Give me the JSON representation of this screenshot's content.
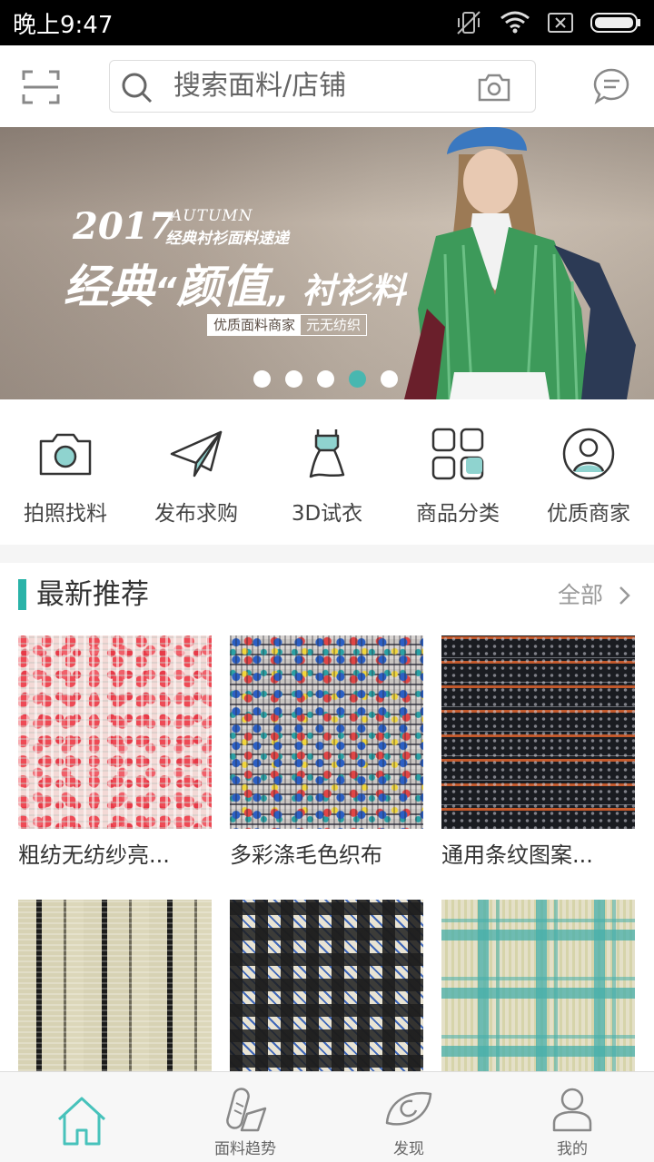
{
  "status_bar": {
    "time": "晚上9:47"
  },
  "header": {
    "search_placeholder": "搜索面料/店铺"
  },
  "banner": {
    "year": "2017",
    "season": "AUTUMN",
    "subtitle": "经典衬衫面料速递",
    "headline_1": "经典",
    "headline_2": "颜值",
    "headline_3": "衬衫料",
    "tag_1": "优质面料商家",
    "tag_2": "元无纺织",
    "active_slide": 4,
    "slide_count": 5
  },
  "quick_menu": [
    {
      "label": "拍照找料",
      "icon": "camera-icon"
    },
    {
      "label": "发布求购",
      "icon": "paper-plane-icon"
    },
    {
      "label": "3D试衣",
      "icon": "dress-icon"
    },
    {
      "label": "商品分类",
      "icon": "grid-icon"
    },
    {
      "label": "优质商家",
      "icon": "merchant-icon"
    }
  ],
  "recommend": {
    "title": "最新推荐",
    "all_label": "全部",
    "items": [
      {
        "name": "粗纺无纺纱亮..."
      },
      {
        "name": "多彩涤毛色织布"
      },
      {
        "name": "通用条纹图案..."
      },
      {
        "name": ""
      },
      {
        "name": ""
      },
      {
        "name": ""
      }
    ]
  },
  "tab_bar": [
    {
      "label": "",
      "icon": "home-icon"
    },
    {
      "label": "面料趋势",
      "icon": "fabric-trend-icon"
    },
    {
      "label": "发现",
      "icon": "discover-icon"
    },
    {
      "label": "我的",
      "icon": "profile-icon"
    }
  ],
  "colors": {
    "accent": "#2ab3a8",
    "active_dot": "#48b7b0",
    "icon_fill": "#8fd3cf"
  }
}
